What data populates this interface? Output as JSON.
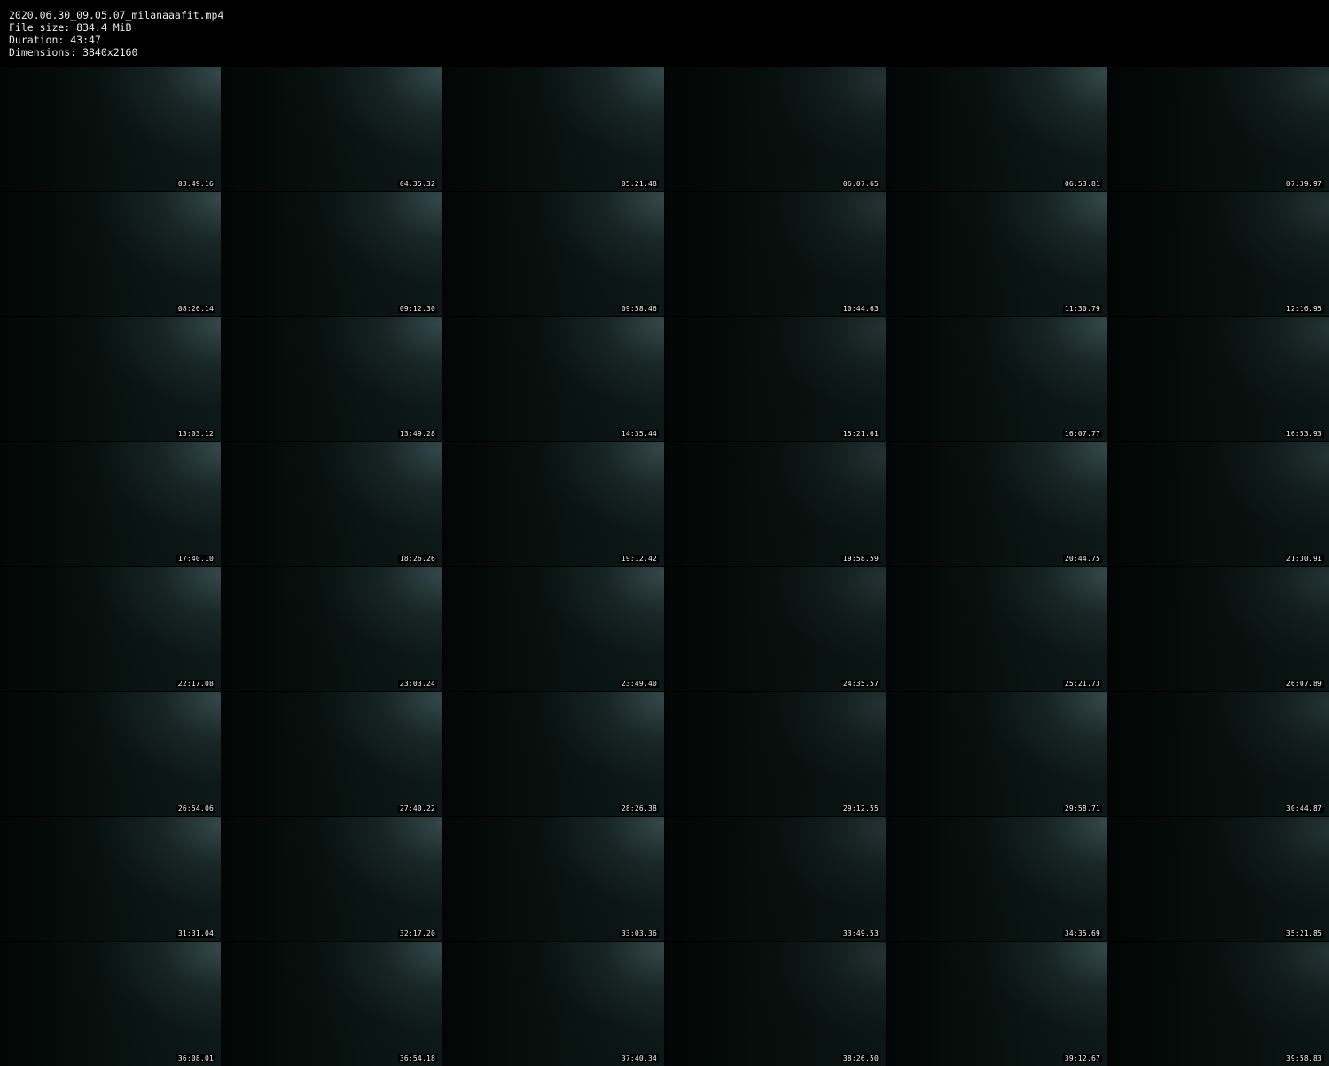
{
  "info": {
    "filename": "2020.06.30_09.05.07_milanaaafit.mp4",
    "file_size": "File size: 834.4 MiB",
    "duration": "Duration: 43:47",
    "dimensions": "Dimensions: 3840x2160"
  },
  "thumbnails": [
    "03:49.16",
    "04:35.32",
    "05:21.48",
    "06:07.65",
    "06:53.81",
    "07:39.97",
    "08:26.14",
    "09:12.30",
    "09:58.46",
    "10:44.63",
    "11:30.79",
    "12:16.95",
    "13:03.12",
    "13:49.28",
    "14:35.44",
    "15:21.61",
    "16:07.77",
    "16:53.93",
    "17:40.10",
    "18:26.26",
    "19:12.42",
    "19:58.59",
    "20:44.75",
    "21:30.91",
    "22:17.08",
    "23:03.24",
    "23:49.40",
    "24:35.57",
    "25:21.73",
    "26:07.89",
    "26:54.06",
    "27:40.22",
    "28:26.38",
    "29:12.55",
    "29:58.71",
    "30:44.87",
    "31:31.04",
    "32:17.20",
    "33:03.36",
    "33:49.53",
    "34:35.69",
    "35:21.85",
    "36:08.01",
    "36:54.18",
    "37:40.34",
    "38:26.50",
    "39:12.67",
    "39:58.83"
  ]
}
